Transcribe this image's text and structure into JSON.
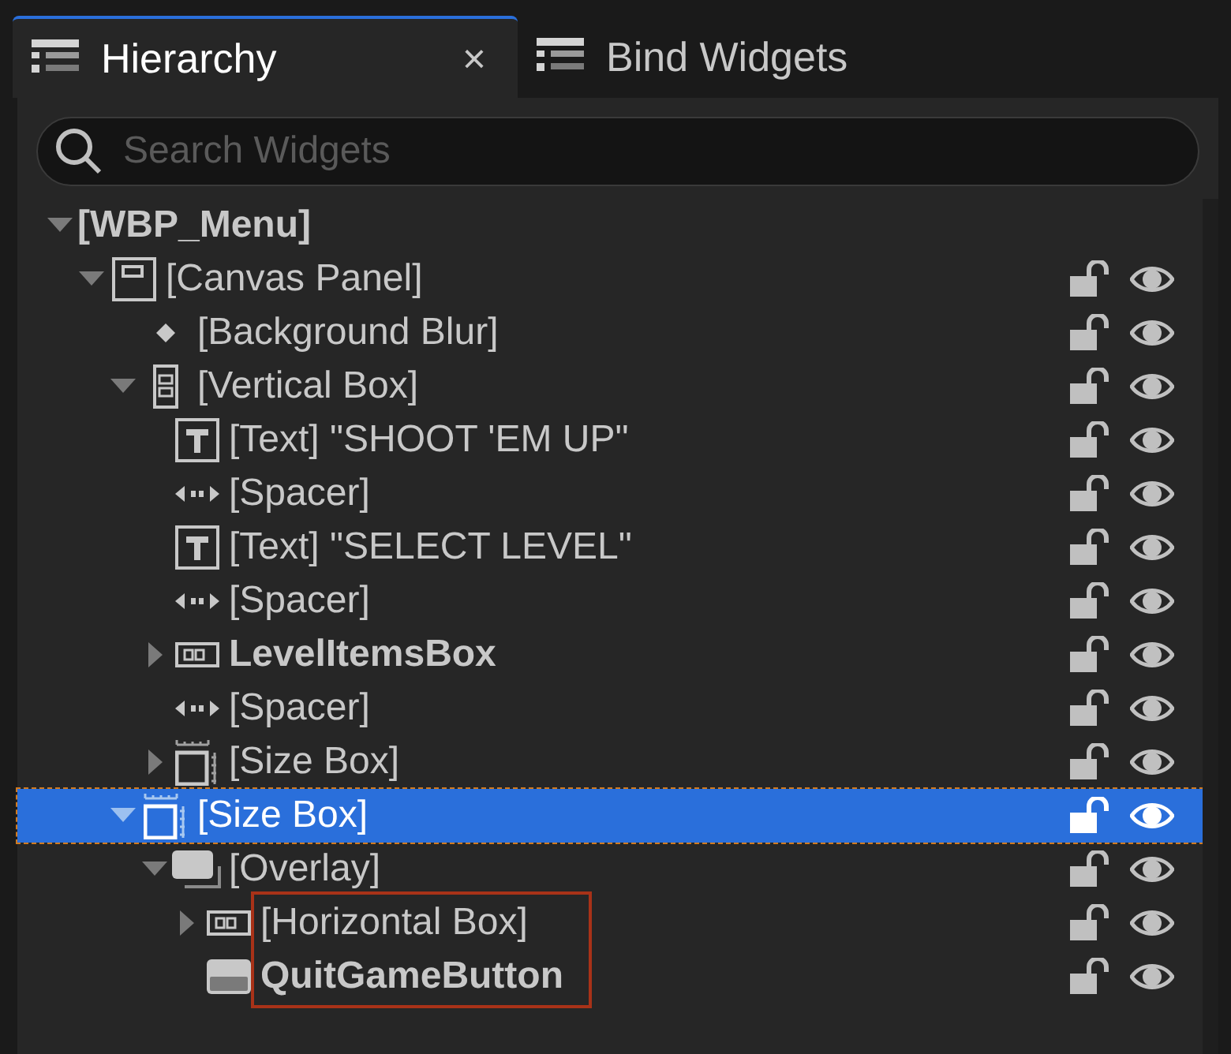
{
  "tabs": [
    {
      "label": "Hierarchy",
      "selected": true,
      "close": "×"
    },
    {
      "label": "Bind Widgets",
      "selected": false
    }
  ],
  "search": {
    "placeholder": "Search Widgets"
  },
  "tree": [
    {
      "label": "[WBP_Menu]",
      "bold": true,
      "expanded": true,
      "selected": false,
      "children": [
        {
          "label": "[Canvas Panel]",
          "kind": "canvas",
          "expanded": true,
          "selected": false,
          "locked": false,
          "visible": true,
          "children": [
            {
              "label": "[Background Blur]",
              "kind": "blur",
              "selected": false,
              "locked": false,
              "visible": true
            },
            {
              "label": "[Vertical Box]",
              "kind": "vbox",
              "expanded": true,
              "selected": false,
              "locked": false,
              "visible": true,
              "children": [
                {
                  "label": "[Text] \"SHOOT 'EM UP\"",
                  "kind": "text",
                  "selected": false,
                  "locked": false,
                  "visible": true
                },
                {
                  "label": "[Spacer]",
                  "kind": "spacer",
                  "selected": false,
                  "locked": false,
                  "visible": true
                },
                {
                  "label": "[Text] \"SELECT LEVEL\"",
                  "kind": "text",
                  "selected": false,
                  "locked": false,
                  "visible": true
                },
                {
                  "label": "[Spacer]",
                  "kind": "spacer",
                  "selected": false,
                  "locked": false,
                  "visible": true
                },
                {
                  "label": "LevelItemsBox",
                  "kind": "hbox",
                  "bold": true,
                  "expanded": false,
                  "selected": false,
                  "locked": false,
                  "visible": true
                },
                {
                  "label": "[Spacer]",
                  "kind": "spacer",
                  "selected": false,
                  "locked": false,
                  "visible": true
                },
                {
                  "label": "[Size Box]",
                  "kind": "sizebox",
                  "expanded": false,
                  "selected": false,
                  "locked": false,
                  "visible": true
                }
              ]
            },
            {
              "label": "[Size Box]",
              "kind": "sizebox",
              "expanded": true,
              "selected": true,
              "locked": false,
              "visible": true,
              "children": [
                {
                  "label": "[Overlay]",
                  "kind": "overlay",
                  "expanded": true,
                  "selected": false,
                  "locked": false,
                  "visible": true,
                  "children": [
                    {
                      "label": "[Horizontal Box]",
                      "kind": "hbox",
                      "expanded": false,
                      "selected": false,
                      "locked": false,
                      "visible": true,
                      "outlined": true
                    },
                    {
                      "label": "QuitGameButton",
                      "kind": "button",
                      "bold": true,
                      "selected": false,
                      "locked": false,
                      "visible": true,
                      "outlined": true
                    }
                  ]
                }
              ]
            }
          ]
        }
      ]
    }
  ]
}
